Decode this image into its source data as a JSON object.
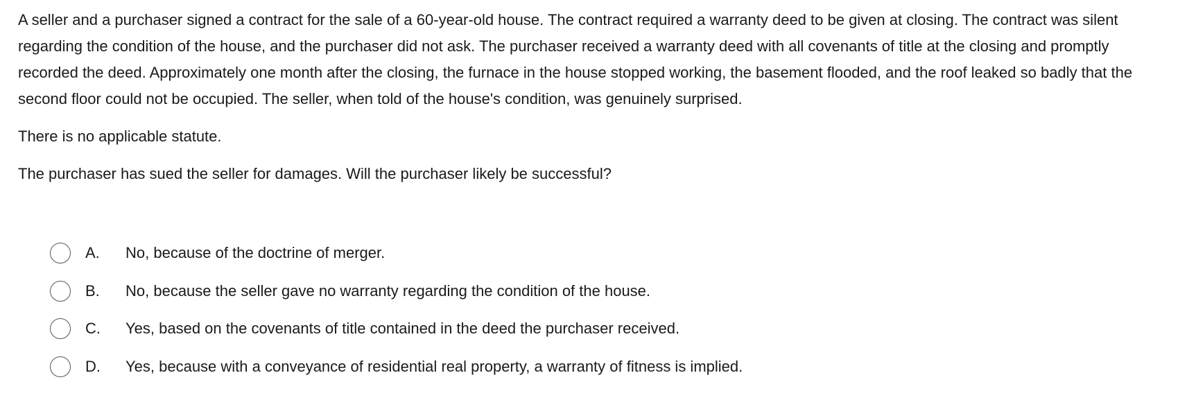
{
  "question": {
    "stem": "A seller and a purchaser signed a contract for the sale of a 60-year-old house.  The contract required a warranty deed to be given at closing.  The contract was silent regarding the condition of the house, and the purchaser did not ask.  The purchaser received a warranty deed with all covenants of title at the closing and promptly recorded the deed.  Approximately one month after the closing, the furnace in the house stopped working, the basement flooded, and the roof leaked so badly that the second floor could not be occupied.  The seller, when told of the house's condition, was genuinely surprised.",
    "statute_note": "There is no applicable statute.",
    "prompt": "The purchaser has sued the seller for damages.  Will the purchaser likely be successful?"
  },
  "options": [
    {
      "letter": "A.",
      "text": "No, because of the doctrine of merger.",
      "selected": false
    },
    {
      "letter": "B.",
      "text": "No, because the seller gave no warranty regarding the condition of the house.",
      "selected": false
    },
    {
      "letter": "C.",
      "text": "Yes, based on the covenants of title contained in the deed the purchaser received.",
      "selected": false
    },
    {
      "letter": "D.",
      "text": "Yes, because with a conveyance of residential real property, a warranty of fitness is implied.",
      "selected": false
    }
  ]
}
